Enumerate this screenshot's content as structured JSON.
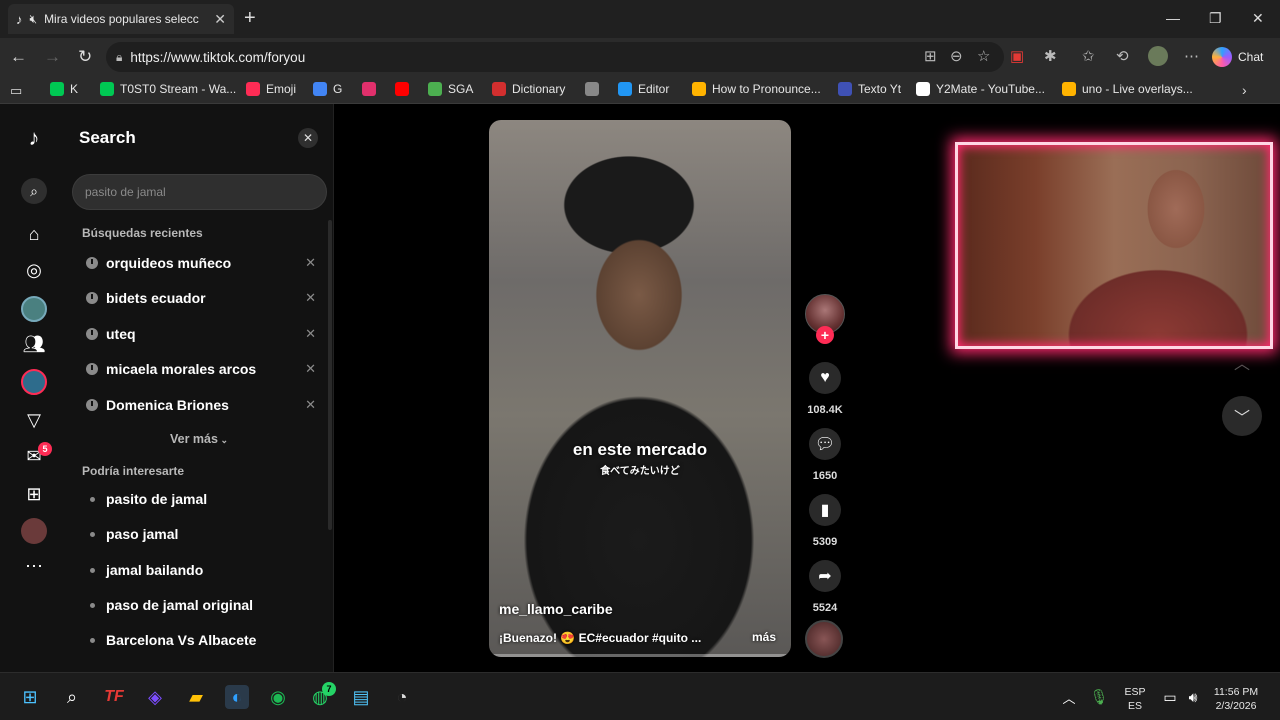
{
  "browser": {
    "tab_title": "Mira videos populares selecc",
    "url": "https://www.tiktok.com/foryou",
    "chat_label": "Chat",
    "bookmarks": [
      {
        "label": "K",
        "icon": "k-icon",
        "color": "#00c853"
      },
      {
        "label": "T0ST0 Stream - Wa...",
        "icon": "k-icon",
        "color": "#00c853"
      },
      {
        "label": "Emoji",
        "icon": "emoji-icon",
        "color": "#fe2c55"
      },
      {
        "label": "G",
        "icon": "google-icon",
        "color": "#4285f4"
      },
      {
        "label": "",
        "icon": "instagram-icon",
        "color": "#e1306c"
      },
      {
        "label": "",
        "icon": "youtube-icon",
        "color": "#ff0000"
      },
      {
        "label": "SGA",
        "icon": "sga-icon",
        "color": "#4caf50"
      },
      {
        "label": "Dictionary",
        "icon": "dictionary-icon",
        "color": "#d32f2f"
      },
      {
        "label": "",
        "icon": "openai-icon",
        "color": "#888888"
      },
      {
        "label": "Editor",
        "icon": "editor-icon",
        "color": "#2196f3"
      },
      {
        "label": "How to Pronounce...",
        "icon": "pronounce-icon",
        "color": "#ffb300"
      },
      {
        "label": "Texto Yt",
        "icon": "texto-icon",
        "color": "#3f51b5"
      },
      {
        "label": "Y2Mate - YouTube...",
        "icon": "y2mate-icon",
        "color": "#ffffff"
      },
      {
        "label": "uno - Live overlays...",
        "icon": "uno-icon",
        "color": "#ffb300"
      }
    ]
  },
  "search": {
    "title": "Search",
    "placeholder": "pasito de jamal",
    "recent_heading": "Búsquedas recientes",
    "recent": [
      "orquideos muñeco",
      "bidets ecuador",
      "uteq",
      "micaela morales arcos",
      "Domenica Briones"
    ],
    "ver_mas": "Ver más",
    "suggest_heading": "Podría interesarte",
    "suggestions": [
      "pasito de jamal",
      "paso jamal",
      "jamal bailando",
      "paso de jamal original",
      "Barcelona Vs Albacete"
    ]
  },
  "video": {
    "caption_main": "en este mercado",
    "caption_sub": "食べてみたいけど",
    "username": "me_llamo_caribe",
    "description": "¡Buenazo! 😍 EC#ecuador #quito ...",
    "more": "más",
    "likes": "108.4K",
    "comments": "1650",
    "saves": "5309",
    "shares": "5524"
  },
  "rail_badge": "5",
  "taskbar": {
    "lang_top": "ESP",
    "lang_bottom": "ES",
    "time": "11:56 PM",
    "date": "2/3/2026",
    "whatsapp_badge": "7"
  },
  "colors": {
    "accent": "#fe2c55",
    "overlay_glow": "#ff2b6e"
  }
}
